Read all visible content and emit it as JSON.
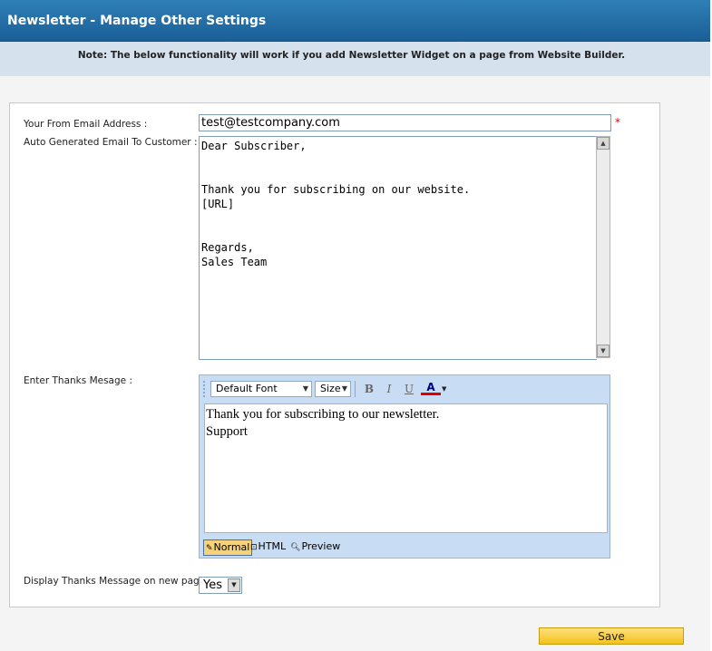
{
  "header": {
    "title": "Newsletter - Manage Other Settings"
  },
  "note": {
    "text": "Note: The below functionality will work if you add Newsletter Widget on a page from Website Builder."
  },
  "form": {
    "from_email": {
      "label": "Your From Email Address :",
      "value": "test@testcompany.com",
      "required_marker": "*"
    },
    "auto_email": {
      "label": "Auto Generated Email To Customer :",
      "value": "Dear Subscriber,\n\n\nThank you for subscribing on our website.\n[URL]\n\n\nRegards,\nSales Team"
    },
    "thanks_message": {
      "label": "Enter Thanks Mesage :",
      "toolbar": {
        "font": "Default Font",
        "size": "Size",
        "bold": "B",
        "italic": "I",
        "underline": "U",
        "color": "A"
      },
      "content_line1": "Thank you for subscribing to our newsletter.",
      "content_line2": "Support",
      "modes": {
        "normal": "Normal",
        "html": "HTML",
        "preview": "Preview"
      }
    },
    "display_new_page": {
      "label": "Display Thanks Message on new page:",
      "selected": "Yes"
    }
  },
  "actions": {
    "save_label": "Save"
  },
  "colors": {
    "header_blue": "#2470aa",
    "note_band": "#d5e2ee",
    "save_yellow": "#f9d64a",
    "required_red": "#dd0000"
  }
}
